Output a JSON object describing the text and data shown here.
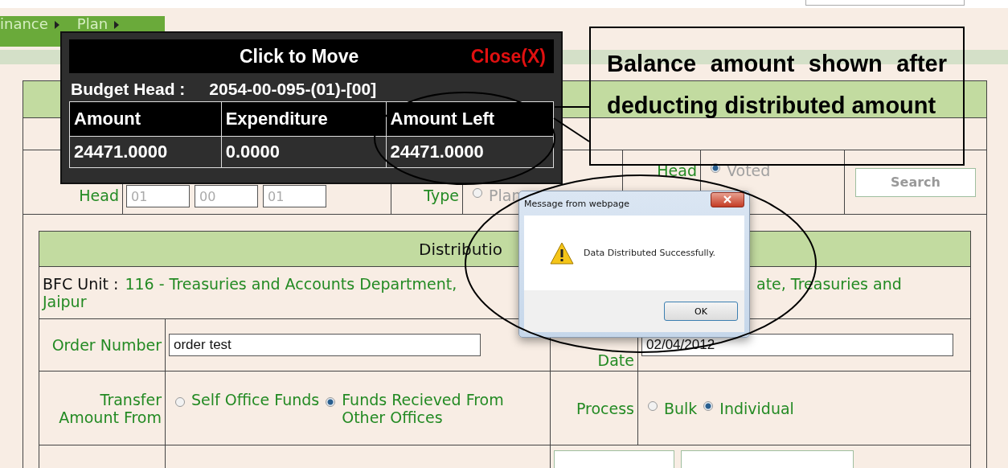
{
  "breadcrumb": [
    {
      "label": "inance"
    },
    {
      "label": "Plan"
    }
  ],
  "form": {
    "budget_head": {
      "label": "Head",
      "disabled": true,
      "fields": [
        "01",
        "00",
        "01"
      ]
    },
    "bfc_type": {
      "label": "Type",
      "disabled": true,
      "options": [
        {
          "label": "Plan",
          "selected": false
        }
      ]
    },
    "head_type": {
      "label": "Head",
      "disabled": true,
      "options": [
        {
          "label": "Voted",
          "selected": true
        }
      ]
    },
    "search_button": {
      "label": "Search",
      "disabled": true
    }
  },
  "distribution": {
    "title": "Distributio",
    "bfc_unit_label": "BFC Unit :",
    "bfc_unit": [
      "116 - Treasuries and Accounts Department,",
      "ate, Treasuries and",
      "Jaipur"
    ],
    "order_number": {
      "label": "Order Number",
      "value": "order test"
    },
    "order_date": {
      "label": "Date",
      "value": "02/04/2012"
    },
    "transfer_from": {
      "label": "Transfer Amount From",
      "options": [
        {
          "label": "Self Office Funds",
          "selected": false
        },
        {
          "label": "Funds Recieved From Other Offices",
          "selected": true
        }
      ]
    },
    "process": {
      "label": "Process",
      "options": [
        {
          "label": "Bulk",
          "selected": false
        },
        {
          "label": "Individual",
          "selected": true
        }
      ]
    },
    "buttons": [
      {
        "kind": "button"
      },
      {
        "kind": "button"
      }
    ]
  },
  "budget_popup": {
    "title": "Click to Move",
    "close": "Close(X)",
    "head_label": "Budget Head :",
    "head_value": "2054-00-095-(01)-[00]",
    "columns": [
      "Amount",
      "Expenditure",
      "Amount Left"
    ],
    "values": [
      "24471.0000",
      "0.0000",
      "24471.0000"
    ]
  },
  "annotation": {
    "text": "Balance amount shown after deducting distributed amount"
  },
  "dialog": {
    "title": "Message from webpage",
    "message": "Data Distributed Successfully.",
    "ok": "OK"
  }
}
